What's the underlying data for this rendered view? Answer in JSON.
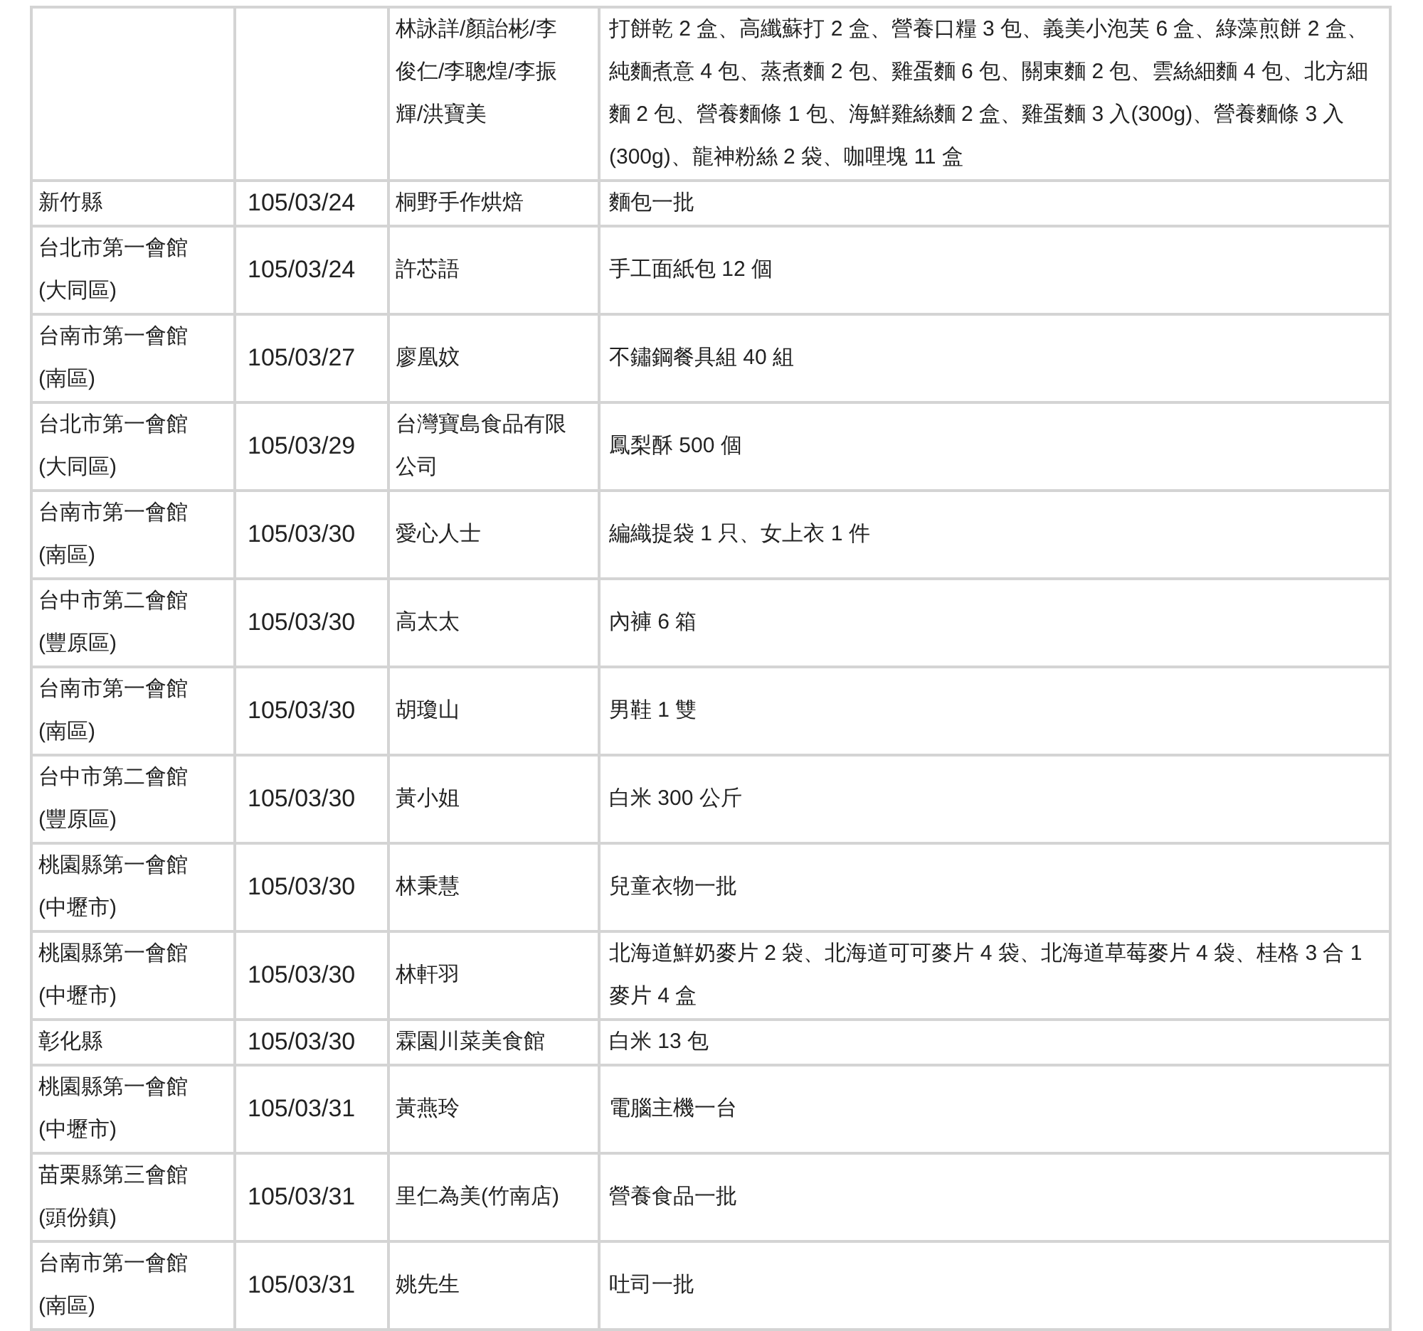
{
  "table": {
    "rows": [
      {
        "column_3": "林詠詳/顏詒彬/李俊仁/李聰煌/李振輝/洪寶美",
        "column_4": "打餅乾 2 盒、高纖蘇打 2 盒、營養口糧 3 包、義美小泡芙 6 盒、綠藻煎餅 2 盒、純麵煮意 4 包、蒸煮麵 2 包、雞蛋麵 6 包、關東麵 2 包、雲絲細麵 4 包、北方細麵 2 包、營養麵條 1 包、海鮮雞絲麵 2 盒、雞蛋麵 3 入(300g)、營養麵條 3 入(300g)、龍神粉絲 2 袋、咖哩塊 11 盒"
      },
      {
        "column_1": "新竹縣",
        "column_2": "105/03/24",
        "column_3": "桐野手作烘焙",
        "column_4": "麵包一批"
      },
      {
        "column_1": "台北市第一會館(大同區)",
        "column_2": "105/03/24",
        "column_3": "許芯語",
        "column_4": "手工面紙包 12 個"
      },
      {
        "column_1": "台南市第一會館(南區)",
        "column_2": "105/03/27",
        "column_3": "廖凰妏",
        "column_4": "不鏽鋼餐具組 40 組"
      },
      {
        "column_1": "台北市第一會館(大同區)",
        "column_2": "105/03/29",
        "column_3": "台灣寶島食品有限公司",
        "column_4": "鳳梨酥 500 個"
      },
      {
        "column_1": "台南市第一會館(南區)",
        "column_2": "105/03/30",
        "column_3": "愛心人士",
        "column_4": "編織提袋 1 只、女上衣 1 件"
      },
      {
        "column_1": "台中市第二會館(豐原區)",
        "column_2": "105/03/30",
        "column_3": "高太太",
        "column_4": "內褲 6 箱"
      },
      {
        "column_1": "台南市第一會館(南區)",
        "column_2": "105/03/30",
        "column_3": "胡瓊山",
        "column_4": "男鞋 1 雙"
      },
      {
        "column_1": "台中市第二會館(豐原區)",
        "column_2": "105/03/30",
        "column_3": "黃小姐",
        "column_4": "白米 300 公斤"
      },
      {
        "column_1": "桃園縣第一會館(中壢市)",
        "column_2": "105/03/30",
        "column_3": "林秉慧",
        "column_4": "兒童衣物一批"
      },
      {
        "column_1": "桃園縣第一會館(中壢市)",
        "column_2": "105/03/30",
        "column_3": "林軒羽",
        "column_4": "北海道鮮奶麥片 2 袋、北海道可可麥片 4 袋、北海道草莓麥片 4 袋、桂格 3 合 1 麥片 4 盒"
      },
      {
        "column_1": "彰化縣",
        "column_2": "105/03/30",
        "column_3": "霖園川菜美食館",
        "column_4": "白米 13 包"
      },
      {
        "column_1": "桃園縣第一會館(中壢市)",
        "column_2": "105/03/31",
        "column_3": "黃燕玲",
        "column_4": "電腦主機一台"
      },
      {
        "column_1": "苗栗縣第三會館(頭份鎮)",
        "column_2": "105/03/31",
        "column_3": "里仁為美(竹南店)",
        "column_4": "營養食品一批"
      },
      {
        "column_1": "台南市第一會館(南區)",
        "column_2": "105/03/31",
        "column_3": "姚先生",
        "column_4": "吐司一批"
      }
    ]
  }
}
